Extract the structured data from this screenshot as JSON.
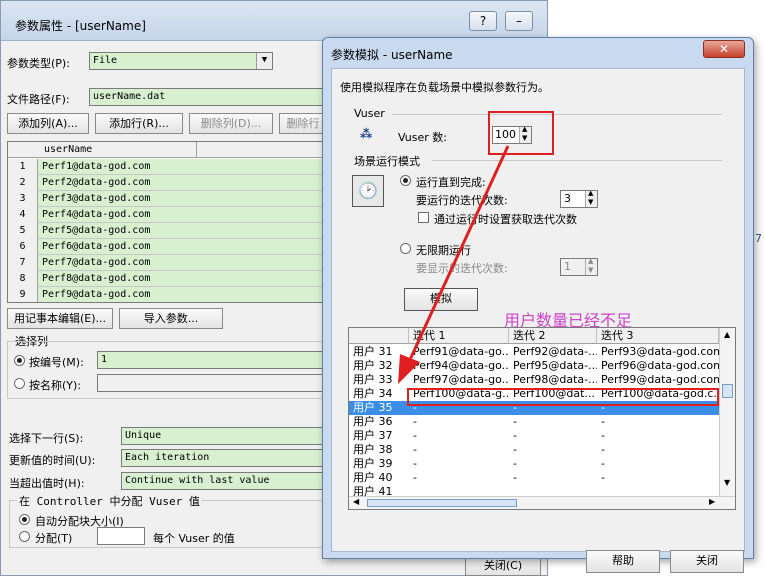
{
  "back_window": {
    "title": "参数属性 - [userName]",
    "help_btn": "?",
    "min_btn": "–",
    "param_type_label": "参数类型(P):",
    "param_type_value": "File",
    "file_path_label": "文件路径(F):",
    "file_path_value": "userName.dat",
    "buttons": {
      "add_column": "添加列(A)...",
      "add_row": "添加行(R)...",
      "delete_column": "删除列(D)...",
      "delete_row": "删除行"
    },
    "grid_header": "userName",
    "rows": [
      {
        "num": "1",
        "value": "Perf1@data-god.com"
      },
      {
        "num": "2",
        "value": "Perf2@data-god.com"
      },
      {
        "num": "3",
        "value": "Perf3@data-god.com"
      },
      {
        "num": "4",
        "value": "Perf4@data-god.com"
      },
      {
        "num": "5",
        "value": "Perf5@data-god.com"
      },
      {
        "num": "6",
        "value": "Perf6@data-god.com"
      },
      {
        "num": "7",
        "value": "Perf7@data-god.com"
      },
      {
        "num": "8",
        "value": "Perf8@data-god.com"
      },
      {
        "num": "9",
        "value": "Perf9@data-god.com"
      }
    ],
    "edit_notepad": "用记事本编辑(E)...",
    "import_params": "导入参数...",
    "select_column_group": "选择列",
    "by_number_label": "按编号(M):",
    "by_number_value": "1",
    "by_name_label": "按名称(Y):",
    "select_next_row_label": "选择下一行(S):",
    "select_next_row_value": "Unique",
    "update_value_label": "更新值的时间(U):",
    "update_value_value": "Each iteration",
    "out_of_values_label": "当超出值时(H):",
    "out_of_values_value": "Continue with last value",
    "controller_group": "在 Controller 中分配 Vuser 值",
    "auto_allocate": "自动分配块大小(I)",
    "allocate": "分配(T)",
    "per_vuser": "每个 Vuser 的值",
    "close": "关闭(C)"
  },
  "dialog": {
    "title": "参数模拟 - userName",
    "close_btn": "✕",
    "description": "使用模拟程序在负载场景中模拟参数行为。",
    "vuser_section": "Vuser",
    "vuser_count_label": "Vuser 数:",
    "vuser_count": "100",
    "run_mode_section": "场景运行模式",
    "run_until_complete": "运行直到完成:",
    "iterations_label": "要运行的迭代次数:",
    "iterations_value": "3",
    "get_iterations_label": "通过运行时设置获取迭代次数",
    "run_indefinitely": "无限期运行",
    "display_iterations_label": "要显示的迭代次数:",
    "display_iterations_value": "1",
    "simulate_btn": "模拟",
    "annotation": "用户数量已经不足",
    "table_headers": [
      "迭代 1",
      "迭代 2",
      "迭代 3"
    ],
    "table_rows": [
      {
        "user": "用户 31",
        "it1": "Perf91@data-go...",
        "it2": "Perf92@data-...",
        "it3": "Perf93@data-god.com"
      },
      {
        "user": "用户 32",
        "it1": "Perf94@data-go...",
        "it2": "Perf95@data-...",
        "it3": "Perf96@data-god.com"
      },
      {
        "user": "用户 33",
        "it1": "Perf97@data-go...",
        "it2": "Perf98@data-...",
        "it3": "Perf99@data-god.com"
      },
      {
        "user": "用户 34",
        "it1": "Perf100@data-g...",
        "it2": "Perf100@dat...",
        "it3": "Perf100@data-god.c..."
      },
      {
        "user": "用户 35",
        "it1": "-",
        "it2": "-",
        "it3": "-"
      },
      {
        "user": "用户 36",
        "it1": "-",
        "it2": "-",
        "it3": "-"
      },
      {
        "user": "用户 37",
        "it1": "-",
        "it2": "-",
        "it3": "-"
      },
      {
        "user": "用户 38",
        "it1": "-",
        "it2": "-",
        "it3": "-"
      },
      {
        "user": "用户 39",
        "it1": "-",
        "it2": "-",
        "it3": "-"
      },
      {
        "user": "用户 40",
        "it1": "-",
        "it2": "-",
        "it3": "-"
      },
      {
        "user": "用户 41",
        "it1": "",
        "it2": "",
        "it3": ""
      }
    ],
    "help": "帮助",
    "close": "关闭"
  },
  "colors": {
    "field_green": "#d8f0d0",
    "selection_blue": "#3a8ee6",
    "annotation_red": "#e02020",
    "annotation_magenta": "#cc44cc"
  }
}
